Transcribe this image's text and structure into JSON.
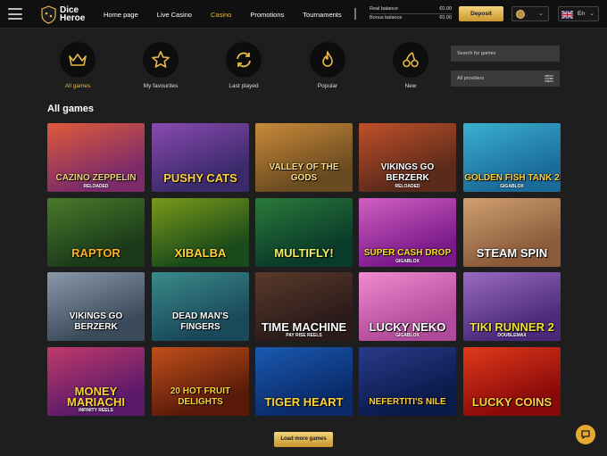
{
  "header": {
    "logo_line1": "Dice",
    "logo_line2": "Heroe",
    "nav": [
      "Home page",
      "Live Casino",
      "Casino",
      "Promotions",
      "Tournaments"
    ],
    "active_nav": "Casino",
    "real_balance_label": "Real balance",
    "real_balance_value": "€0.00",
    "bonus_balance_label": "Bonus balance",
    "bonus_balance_value": "€0.00",
    "deposit_label": "Deposit",
    "language": "En"
  },
  "categories": [
    {
      "label": "All games",
      "icon": "crown-icon",
      "active": true
    },
    {
      "label": "My favourites",
      "icon": "star-icon",
      "active": false
    },
    {
      "label": "Last played",
      "icon": "refresh-icon",
      "active": false
    },
    {
      "label": "Popular",
      "icon": "flame-icon",
      "active": false
    },
    {
      "label": "New",
      "icon": "cherries-icon",
      "active": false
    }
  ],
  "filters": {
    "search_placeholder": "Search for games",
    "providers_label": "All providers"
  },
  "section_title": "All games",
  "games": [
    {
      "name": "CAZINO ZEPPELIN",
      "sub": "RELOADED",
      "bg": "#7b2b6a",
      "bg2": "#e05a3a",
      "color": "#f2d27a"
    },
    {
      "name": "PUSHY CATS",
      "sub": "",
      "bg": "#3a2a6a",
      "bg2": "#8a4ab0",
      "color": "#ffd23a"
    },
    {
      "name": "VALLEY OF THE GODS",
      "sub": "",
      "bg": "#6a4a20",
      "bg2": "#c98a3a",
      "color": "#ffe08a"
    },
    {
      "name": "VIKINGS GO BERZERK",
      "sub": "RELOADED",
      "bg": "#5a2a1a",
      "bg2": "#c0502a",
      "color": "#ffffff"
    },
    {
      "name": "GOLDEN FISH TANK 2",
      "sub": "GIGABLOX",
      "bg": "#1a6a9a",
      "bg2": "#3ab0d0",
      "color": "#ffd23a"
    },
    {
      "name": "RAPTOR",
      "sub": "",
      "bg": "#1a3a1a",
      "bg2": "#4a7a2a",
      "color": "#ffb020"
    },
    {
      "name": "XIBALBA",
      "sub": "",
      "bg": "#1a4a1a",
      "bg2": "#7a9a1a",
      "color": "#ffd23a"
    },
    {
      "name": "MULTIFLY!",
      "sub": "",
      "bg": "#0a3a2a",
      "bg2": "#2a7a3a",
      "color": "#f0f060"
    },
    {
      "name": "SUPER CASH DROP",
      "sub": "GIGABLOX",
      "bg": "#7a1a8a",
      "bg2": "#d060c0",
      "color": "#ffe020"
    },
    {
      "name": "STEAM SPIN",
      "sub": "",
      "bg": "#8a5a3a",
      "bg2": "#d0a070",
      "color": "#ffffff"
    },
    {
      "name": "VIKINGS GO BERZERK",
      "sub": "",
      "bg": "#3a4a5a",
      "bg2": "#8a9aaa",
      "color": "#ffffff"
    },
    {
      "name": "DEAD MAN'S FINGERS",
      "sub": "",
      "bg": "#1a4a5a",
      "bg2": "#3a8a8a",
      "color": "#ffffff"
    },
    {
      "name": "TIME MACHINE",
      "sub": "PAY RISE REELS",
      "bg": "#2a1a1a",
      "bg2": "#5a3a2a",
      "color": "#ffffff"
    },
    {
      "name": "LUCKY NEKO",
      "sub": "GIGABLOX",
      "bg": "#b04a9a",
      "bg2": "#f08ad0",
      "color": "#ffffff"
    },
    {
      "name": "TIKI RUNNER 2",
      "sub": "DOUBLEMAX",
      "bg": "#4a2a7a",
      "bg2": "#9a6ac0",
      "color": "#f0e030"
    },
    {
      "name": "MONEY MARIACHI",
      "sub": "INFINITY REELS",
      "bg": "#5a1a6a",
      "bg2": "#c03a6a",
      "color": "#ffd23a"
    },
    {
      "name": "20 HOT FRUIT DELIGHTS",
      "sub": "",
      "bg": "#5a1a0a",
      "bg2": "#c0501a",
      "color": "#ffd23a"
    },
    {
      "name": "TIGER HEART",
      "sub": "",
      "bg": "#0a2a6a",
      "bg2": "#1a5ab0",
      "color": "#ffd23a"
    },
    {
      "name": "NEFERTITI'S NILE",
      "sub": "",
      "bg": "#0a1a4a",
      "bg2": "#2a3a8a",
      "color": "#ffd23a"
    },
    {
      "name": "LUCKY COINS",
      "sub": "",
      "bg": "#8a0a0a",
      "bg2": "#e03a1a",
      "color": "#ffd23a"
    }
  ],
  "load_more_label": "Load more games",
  "colors": {
    "accent": "#e8b84a",
    "background": "#1e1e1e",
    "topbar": "#101010"
  }
}
